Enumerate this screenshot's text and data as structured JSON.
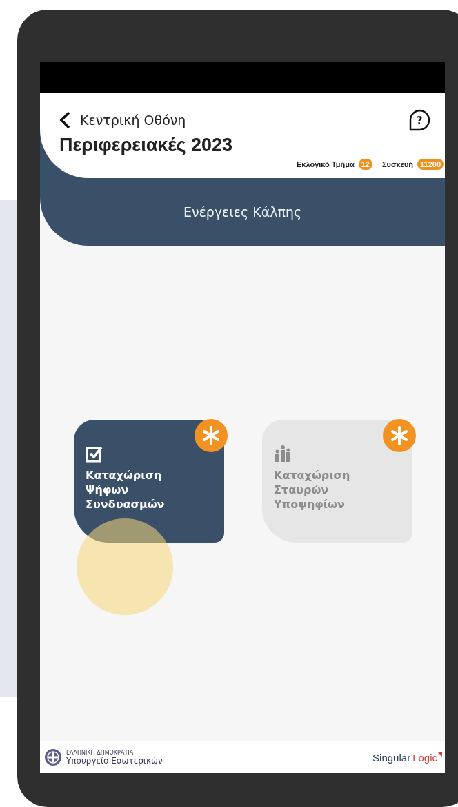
{
  "header": {
    "back_label": "Κεντρική Οθόνη",
    "title": "Περιφερειακές 2023",
    "help_symbol": "?",
    "badges": [
      {
        "label": "Εκλογικό Τμήμα",
        "value": "12"
      },
      {
        "label": "Συσκευή",
        "value": "11200"
      }
    ]
  },
  "section_title": "Ενέργειες Κάλπης",
  "actions": [
    {
      "kind": "checkbox",
      "label": "Καταχώριση Ψήφων Συνδυασμών",
      "disabled": false,
      "required": true
    },
    {
      "kind": "people",
      "label": "Καταχώριση Σταυρών Υποψηφίων",
      "disabled": true,
      "required": true
    }
  ],
  "footer": {
    "ministry_line1": "ΕΛΛΗΝΙΚΗ ΔΗΜΟΚΡΑΤΙΑ",
    "ministry_line2": "Υπουργείο Εσωτερικών",
    "brand_part1": "Singular",
    "brand_part2": "Logic"
  }
}
